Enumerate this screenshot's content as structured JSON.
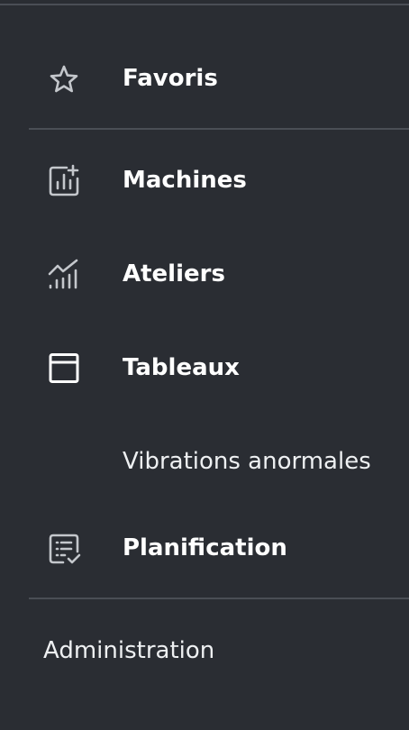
{
  "nav": {
    "items": [
      {
        "label": "Favoris",
        "icon": "star-icon"
      },
      {
        "label": "Machines",
        "icon": "bar-chart-add-icon"
      },
      {
        "label": "Ateliers",
        "icon": "trending-up-icon"
      },
      {
        "label": "Tableaux",
        "icon": "window-icon"
      },
      {
        "label": "Planification",
        "icon": "checklist-icon"
      }
    ],
    "sub_items": [
      {
        "label": "Vibrations anormales"
      }
    ]
  },
  "footer": {
    "admin_label": "Administration"
  },
  "colors": {
    "background": "#2a2d33",
    "divider": "#4a4e55",
    "icon": "#c4c7cc",
    "text": "#ffffff"
  }
}
